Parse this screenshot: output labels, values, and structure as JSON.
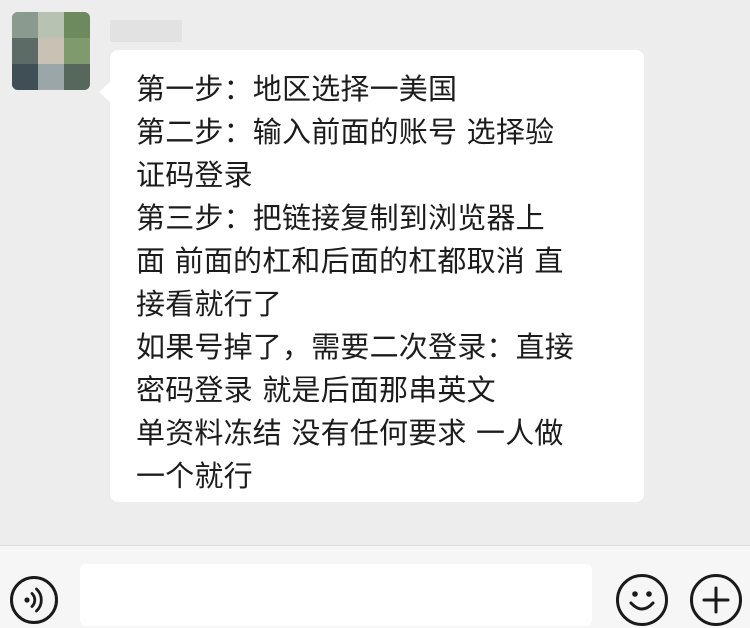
{
  "chat": {
    "message": {
      "lines": [
        "第一步：地区选择一美国",
        "第二步：输入前面的账号 选择验",
        "证码登录",
        "第三步：把链接复制到浏览器上",
        "面 前面的杠和后面的杠都取消  直",
        "接看就行了",
        "如果号掉了，需要二次登录：直接",
        "密码登录  就是后面那串英文",
        "单资料冻结 没有任何要求 一人做",
        "一个就行"
      ]
    }
  },
  "input_bar": {
    "voice_icon": "voice-icon",
    "emoji_icon": "emoji-icon",
    "add_icon": "plus-icon",
    "input_value": ""
  }
}
